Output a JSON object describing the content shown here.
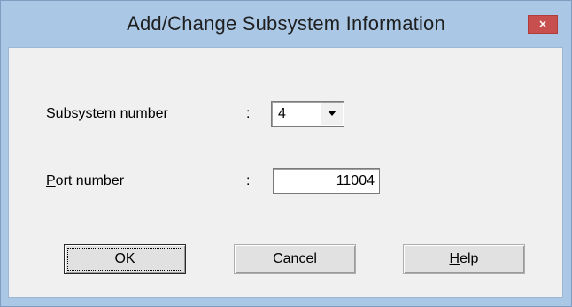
{
  "window": {
    "title": "Add/Change Subsystem Information",
    "close_glyph": "×"
  },
  "form": {
    "subsystem_label_accel": "S",
    "subsystem_label_rest": "ubsystem number",
    "subsystem_colon": ":",
    "subsystem_value": "4",
    "port_label_accel": "P",
    "port_label_rest": "ort number",
    "port_colon": ":",
    "port_value": "11004"
  },
  "buttons": {
    "ok_label": "OK",
    "cancel_label": "Cancel",
    "help_accel": "H",
    "help_rest": "elp"
  },
  "icons": {
    "close": "close-icon",
    "dropdown": "chevron-down-icon"
  },
  "colors": {
    "frame": "#aac8e6",
    "close_button": "#c7504f",
    "client": "#f0f0f0"
  }
}
